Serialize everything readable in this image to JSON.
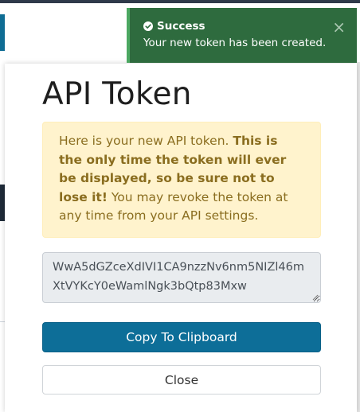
{
  "modal": {
    "title": "API Token",
    "alert": {
      "text_before": "Here is your new API token. ",
      "text_bold": "This is the only time the token will ever be displayed, so be sure not to lose it!",
      "text_after": " You may revoke the token at any time from your API settings."
    },
    "token_value": "WwA5dGZceXdIVI1CA9nzzNv6nm5NIZl46mXtVYKcY0eWamlNgk3bQtp83Mxw",
    "copy_button_label": "Copy To Clipboard",
    "close_button_label": "Close"
  },
  "toast": {
    "title": "Success",
    "message": "Your new token has been created.",
    "close_symbol": "×",
    "icon": "check-circle-icon"
  },
  "colors": {
    "toast_bg": "#2e6b3e",
    "toast_accent": "#4ca862",
    "primary": "#0d6e98",
    "alert_bg": "#fff3cd",
    "alert_text": "#8a6d1f"
  }
}
